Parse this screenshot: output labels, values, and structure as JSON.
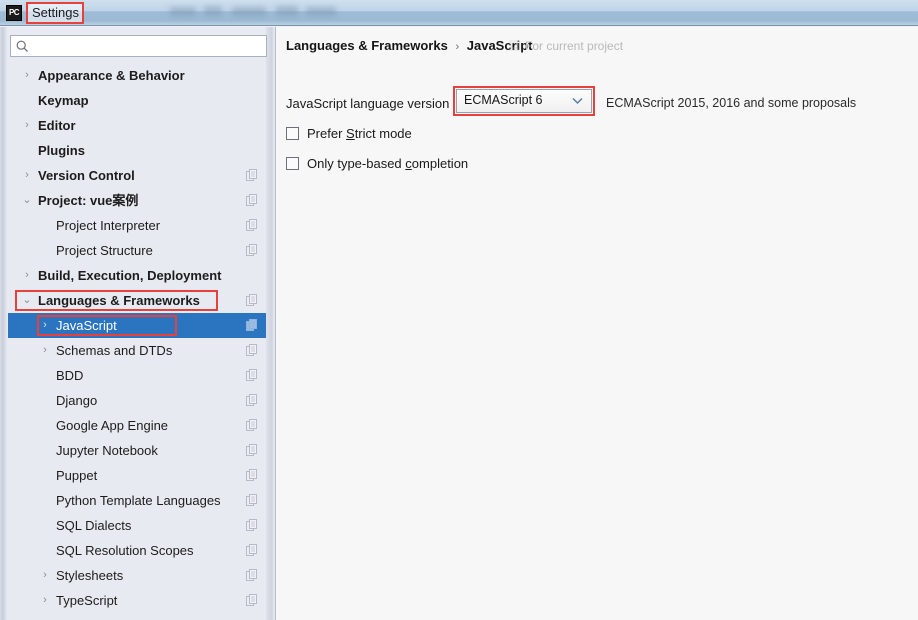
{
  "window": {
    "app_icon": "pycharm-pc-logo",
    "title": "Settings"
  },
  "sidebar": {
    "search": {
      "value": "",
      "placeholder": "",
      "icon": "search-icon"
    },
    "items": [
      {
        "label": "Appearance & Behavior",
        "depth": 0,
        "bold": true,
        "arrow": "›",
        "copy": false,
        "selected": false
      },
      {
        "label": "Keymap",
        "depth": 0,
        "bold": true,
        "arrow": "",
        "copy": false,
        "selected": false
      },
      {
        "label": "Editor",
        "depth": 0,
        "bold": true,
        "arrow": "›",
        "copy": false,
        "selected": false
      },
      {
        "label": "Plugins",
        "depth": 0,
        "bold": true,
        "arrow": "",
        "copy": false,
        "selected": false
      },
      {
        "label": "Version Control",
        "depth": 0,
        "bold": true,
        "arrow": "›",
        "copy": true,
        "selected": false
      },
      {
        "label": "Project: vue案例",
        "depth": 0,
        "bold": true,
        "arrow": "⌄",
        "copy": true,
        "selected": false
      },
      {
        "label": "Project Interpreter",
        "depth": 1,
        "bold": false,
        "arrow": "",
        "copy": true,
        "selected": false
      },
      {
        "label": "Project Structure",
        "depth": 1,
        "bold": false,
        "arrow": "",
        "copy": true,
        "selected": false
      },
      {
        "label": "Build, Execution, Deployment",
        "depth": 0,
        "bold": true,
        "arrow": "›",
        "copy": false,
        "selected": false
      },
      {
        "label": "Languages & Frameworks",
        "depth": 0,
        "bold": true,
        "arrow": "⌄",
        "copy": true,
        "selected": false
      },
      {
        "label": "JavaScript",
        "depth": 1,
        "bold": false,
        "arrow": "›",
        "copy": true,
        "selected": true
      },
      {
        "label": "Schemas and DTDs",
        "depth": 1,
        "bold": false,
        "arrow": "›",
        "copy": true,
        "selected": false
      },
      {
        "label": "BDD",
        "depth": 1,
        "bold": false,
        "arrow": "",
        "copy": true,
        "selected": false
      },
      {
        "label": "Django",
        "depth": 1,
        "bold": false,
        "arrow": "",
        "copy": true,
        "selected": false
      },
      {
        "label": "Google App Engine",
        "depth": 1,
        "bold": false,
        "arrow": "",
        "copy": true,
        "selected": false
      },
      {
        "label": "Jupyter Notebook",
        "depth": 1,
        "bold": false,
        "arrow": "",
        "copy": true,
        "selected": false
      },
      {
        "label": "Puppet",
        "depth": 1,
        "bold": false,
        "arrow": "",
        "copy": true,
        "selected": false
      },
      {
        "label": "Python Template Languages",
        "depth": 1,
        "bold": false,
        "arrow": "",
        "copy": true,
        "selected": false
      },
      {
        "label": "SQL Dialects",
        "depth": 1,
        "bold": false,
        "arrow": "",
        "copy": true,
        "selected": false
      },
      {
        "label": "SQL Resolution Scopes",
        "depth": 1,
        "bold": false,
        "arrow": "",
        "copy": true,
        "selected": false
      },
      {
        "label": "Stylesheets",
        "depth": 1,
        "bold": false,
        "arrow": "›",
        "copy": true,
        "selected": false
      },
      {
        "label": "TypeScript",
        "depth": 1,
        "bold": false,
        "arrow": "›",
        "copy": true,
        "selected": false
      }
    ]
  },
  "main": {
    "breadcrumb": {
      "parent": "Languages & Frameworks",
      "separator": "›",
      "current": "JavaScript"
    },
    "scope": {
      "icon": "project-scope-icon",
      "text": "For current project"
    },
    "version_row": {
      "label": "JavaScript language version",
      "selected": "ECMAScript 6",
      "chevron": "chevron-down-icon",
      "hint": "ECMAScript 2015, 2016 and some proposals",
      "options": [
        "ECMAScript 6"
      ]
    },
    "checkboxes": [
      {
        "label_before": "Prefer ",
        "mnemonic": "S",
        "label_after": "trict mode",
        "checked": false
      },
      {
        "label_before": "Only type-based ",
        "mnemonic": "c",
        "label_after": "ompletion",
        "checked": false
      }
    ]
  },
  "annotations": {
    "color": "#e8403a",
    "boxes": [
      "settings-title",
      "languages-and-frameworks-row",
      "javascript-row",
      "language-version-combo"
    ]
  }
}
